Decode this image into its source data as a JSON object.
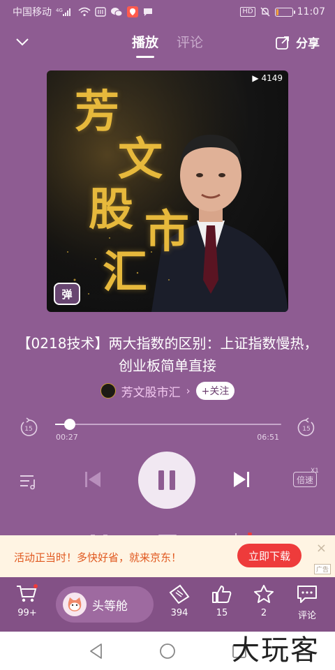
{
  "status_bar": {
    "carrier": "中国移动",
    "network": "4G",
    "time": "11:07",
    "hd_label": "HD",
    "battery_level": 0.15,
    "icons": [
      "signal-icon",
      "wifi-icon",
      "nfc-icon",
      "wechat-icon",
      "app-badge-icon",
      "chat-icon",
      "mute-icon",
      "battery-icon"
    ]
  },
  "header": {
    "tabs": [
      {
        "label": "播放",
        "active": true
      },
      {
        "label": "评论",
        "active": false
      }
    ],
    "share_label": "分享"
  },
  "cover": {
    "play_count": "▶ 4149",
    "title_chars": [
      "芳",
      "文",
      "股",
      "市",
      "汇"
    ],
    "badge_label": "弹"
  },
  "episode": {
    "title": "【0218技术】两大指数的区别：上证指数慢热，创业板简单直接"
  },
  "author": {
    "name": "芳文股市汇",
    "chevron": "›",
    "follow_label": "+关注"
  },
  "player": {
    "rewind_seconds": "15",
    "forward_seconds": "15",
    "current_time": "00:27",
    "total_time": "06:51",
    "progress": 0.066,
    "state": "playing",
    "speed_label": "倍速",
    "speed_value": "X1"
  },
  "ad": {
    "text": "活动正当时！多快好省，就来京东！",
    "button_label": "立即下载",
    "close": "×",
    "tag": "广告"
  },
  "bottom_bar": {
    "cart_count": "99+",
    "cta_label": "头等舱",
    "ticket_count": "394",
    "like_count": "15",
    "star_count": "2",
    "comment_label": "评论"
  },
  "watermark": "大玩客",
  "colors": {
    "background": "#8e5c92",
    "bottom_bar": "#835186",
    "accent_red": "#ee3b3b",
    "gold": "#e7b93c"
  }
}
